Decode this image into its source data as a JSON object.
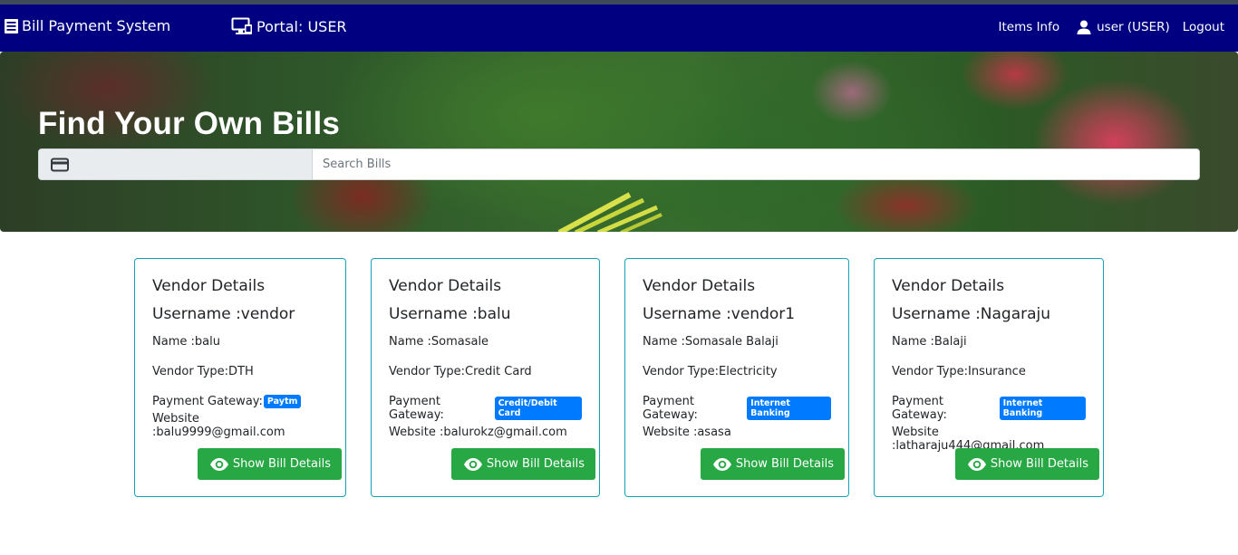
{
  "navbar": {
    "brand": "Bill Payment System",
    "brand_icon": "receipt-icon",
    "portal": "Portal: USER",
    "portal_icon": "desktop-monitor-icon",
    "items_info": "Items Info",
    "user": "user (USER)",
    "user_icon": "person-icon",
    "logout": "Logout",
    "bg_color": "#000080"
  },
  "hero": {
    "title": "Find Your Own Bills",
    "search_icon": "credit-card-icon",
    "search_placeholder": "Search Bills",
    "search_value": ""
  },
  "cards": [
    {
      "title": "Vendor Details",
      "username": "Username :vendor",
      "name": "Name :balu",
      "vendor_type": "Vendor Type:DTH",
      "gateway_label": "Payment Gateway:",
      "gateway": "Paytm",
      "website": "Website :balu9999@gmail.com",
      "button": "Show Bill Details"
    },
    {
      "title": "Vendor Details",
      "username": "Username :balu",
      "name": "Name :Somasale",
      "vendor_type": "Vendor Type:Credit Card",
      "gateway_label": "Payment Gateway:",
      "gateway": "Credit/Debit Card",
      "website": "Website :balurokz@gmail.com",
      "button": "Show Bill Details"
    },
    {
      "title": "Vendor Details",
      "username": "Username :vendor1",
      "name": "Name :Somasale Balaji",
      "vendor_type": "Vendor Type:Electricity",
      "gateway_label": "Payment Gateway:",
      "gateway": "Internet Banking",
      "website": "Website :asasa",
      "button": "Show Bill Details"
    },
    {
      "title": "Vendor Details",
      "username": "Username :Nagaraju",
      "name": "Name :Balaji",
      "vendor_type": "Vendor Type:Insurance",
      "gateway_label": "Payment Gateway:",
      "gateway": "Internet Banking",
      "website": "Website :latharaju444@gmail.com",
      "button": "Show Bill Details"
    }
  ],
  "colors": {
    "card_border": "#17a2b8",
    "button_green": "#28a745",
    "badge_blue": "#007bff"
  }
}
